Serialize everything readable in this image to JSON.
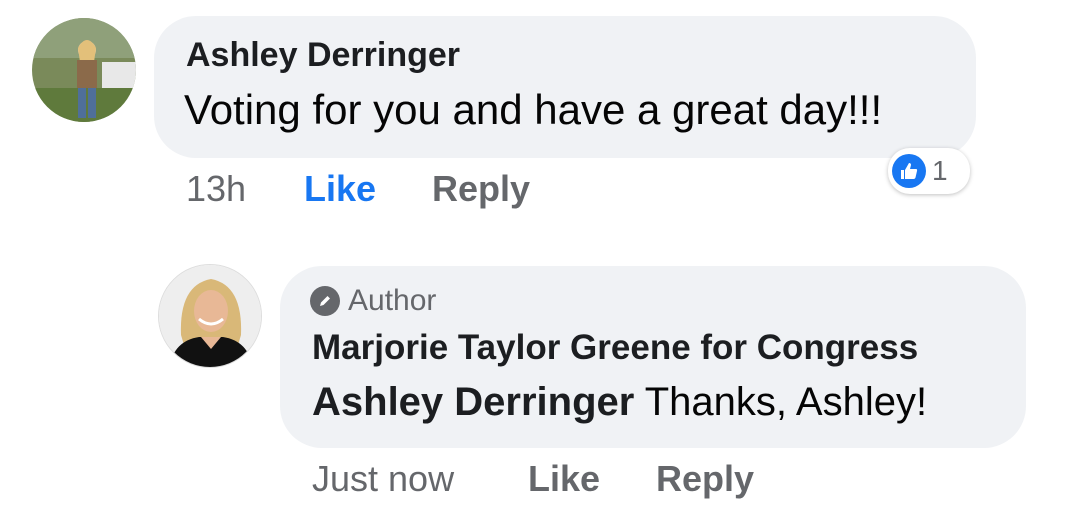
{
  "comment": {
    "author": "Ashley Derringer",
    "text": "Voting for you and have a great day!!!",
    "time": "13h",
    "like_label": "Like",
    "reply_label": "Reply",
    "reaction_count": "1",
    "reaction_icon": "like-thumb-icon",
    "accent": "#1877f2"
  },
  "reply": {
    "author_badge": "Author",
    "author": "Marjorie Taylor Greene for Congress",
    "mention": "Ashley Derringer",
    "text": "Thanks, Ashley!",
    "time": "Just now",
    "like_label": "Like",
    "reply_label": "Reply"
  }
}
